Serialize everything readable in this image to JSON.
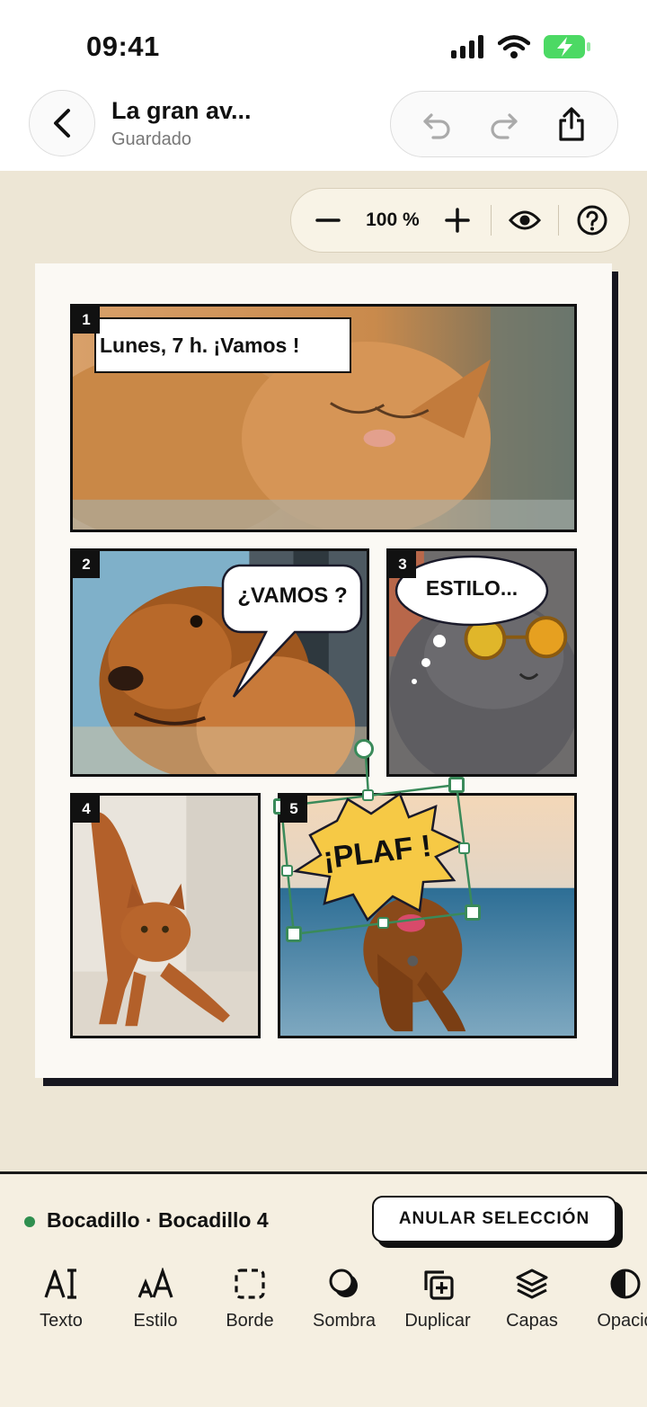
{
  "status": {
    "time": "09:41"
  },
  "header": {
    "title": "La gran av...",
    "subtitle": "Guardado"
  },
  "zoom": {
    "level": "100 %"
  },
  "panels": [
    {
      "num": "1",
      "caption": "Lunes, 7 h. ¡Vamos !"
    },
    {
      "num": "2",
      "bubble": "¿VAMOS ?"
    },
    {
      "num": "3",
      "bubble": "ESTILO..."
    },
    {
      "num": "4"
    },
    {
      "num": "5",
      "burst": "¡PLAF !"
    }
  ],
  "selection": {
    "label": "Bocadillo · Bocadillo 4",
    "deselect": "ANULAR SELECCIÓN"
  },
  "tools": [
    {
      "label": "Texto",
      "icon": "text-icon"
    },
    {
      "label": "Estilo",
      "icon": "font-size-icon"
    },
    {
      "label": "Borde",
      "icon": "border-icon"
    },
    {
      "label": "Sombra",
      "icon": "shadow-icon"
    },
    {
      "label": "Duplicar",
      "icon": "duplicate-icon"
    },
    {
      "label": "Capas",
      "icon": "layers-icon"
    },
    {
      "label": "Opacid",
      "icon": "opacity-icon"
    }
  ],
  "colors": {
    "accent": "#2f8f4f",
    "battery": "#4cd964",
    "canvas": "#ede6d5",
    "burst": "#f6c945"
  }
}
